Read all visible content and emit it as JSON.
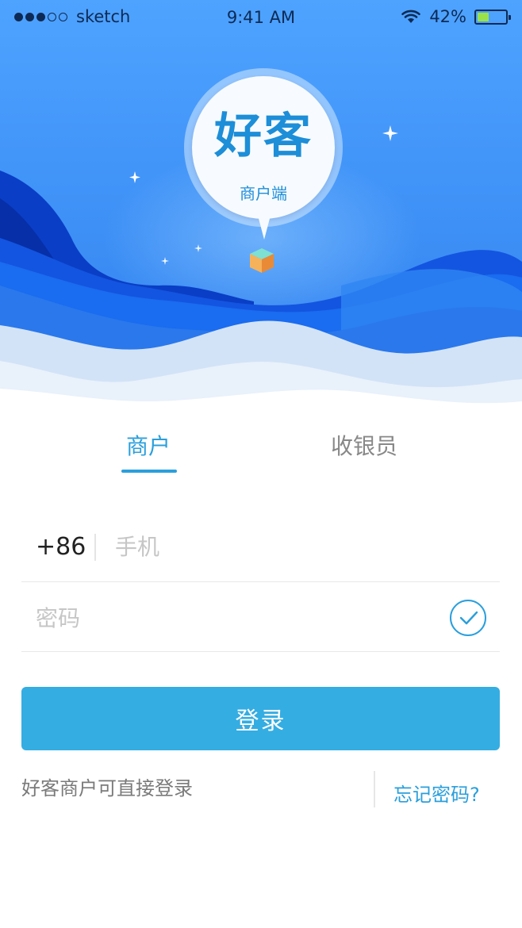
{
  "status_bar": {
    "signal_dots_filled": 3,
    "signal_dots_total": 5,
    "carrier": "sketch",
    "time": "9:41 AM",
    "wifi_icon": "wifi-icon",
    "battery_text": "42%",
    "battery_level": 0.42
  },
  "logo": {
    "title": "好客",
    "subtitle": "商户端"
  },
  "tabs": [
    {
      "label": "商户",
      "active": true
    },
    {
      "label": "收银员",
      "active": false
    }
  ],
  "phone_field": {
    "country_code": "+86",
    "placeholder": "手机",
    "value": ""
  },
  "password_field": {
    "placeholder": "密码",
    "value": "",
    "toggle_icon": "check-circle-icon"
  },
  "login_button_label": "登录",
  "hint_text": "好客商户可直接登录",
  "forgot_password_label": "忘记密码?",
  "colors": {
    "accent": "#2a9fdc",
    "button": "#34ade2",
    "hero_blue": "#4c9dff",
    "hero_dark": "#0b3fc8"
  }
}
